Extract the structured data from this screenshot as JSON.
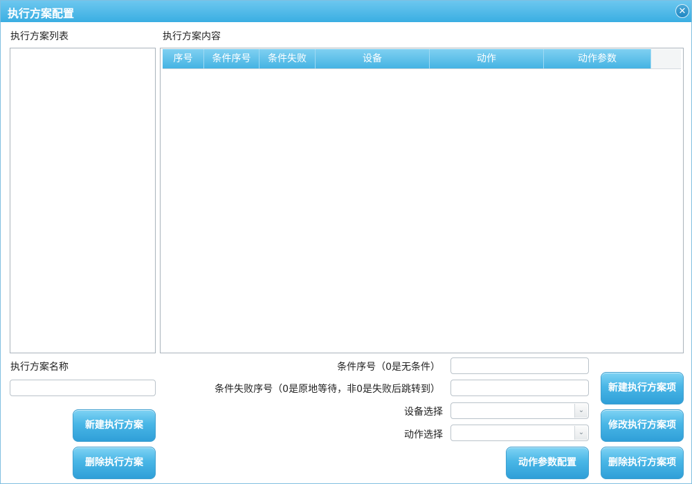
{
  "window": {
    "title": "执行方案配置",
    "close_glyph": "✕"
  },
  "left": {
    "list_label": "执行方案列表",
    "name_label": "执行方案名称",
    "name_value": "",
    "new_button": "新建执行方案",
    "delete_button": "删除执行方案"
  },
  "content": {
    "label": "执行方案内容",
    "columns": [
      "序号",
      "条件序号",
      "条件失败",
      "设备",
      "动作",
      "动作参数"
    ]
  },
  "form": {
    "cond_index_label": "条件序号（0是无条件）",
    "cond_fail_label": "条件失败序号（0是原地等待，非0是失败后跳转到）",
    "device_label": "设备选择",
    "action_label": "动作选择",
    "cond_index_value": "",
    "cond_fail_value": "",
    "device_value": "",
    "action_value": "",
    "action_param_button": "动作参数配置"
  },
  "right_buttons": {
    "new_item": "新建执行方案项",
    "edit_item": "修改执行方案项",
    "delete_item": "删除执行方案项"
  },
  "colors": {
    "accent": "#3aaee2",
    "header": "#45b3e3"
  }
}
